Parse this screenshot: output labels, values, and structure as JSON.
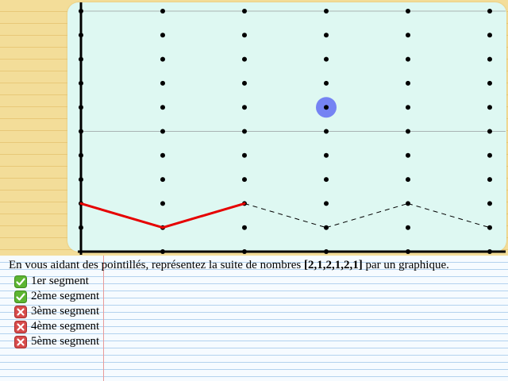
{
  "instruction": {
    "prefix": "En vous aidant des pointillés, représentez la suite de nombres ",
    "sequence": "[2,1,2,1,2,1]",
    "suffix": " par un graphique."
  },
  "segments": [
    {
      "label": "1er segment",
      "status": "done",
      "icon": "check-icon"
    },
    {
      "label": "2ème segment",
      "status": "done",
      "icon": "check-icon"
    },
    {
      "label": "3ème segment",
      "status": "todo",
      "icon": "cross-icon"
    },
    {
      "label": "4ème segment",
      "status": "todo",
      "icon": "cross-icon"
    },
    {
      "label": "5ème segment",
      "status": "todo",
      "icon": "cross-icon"
    }
  ],
  "graph": {
    "columns": 6,
    "rows": 10,
    "sequence": [
      2,
      1,
      2,
      1,
      2,
      1
    ],
    "drawn_segments": 2,
    "cursor": {
      "col": 3,
      "row": 6
    },
    "colors": {
      "background": "#def8f2",
      "axis": "#000000",
      "grid_line": "#a9b3b3",
      "dot": "#000000",
      "drawn": "#e60000",
      "guide": "#000000",
      "cursor": "#6f7cf2",
      "check": "#5cb532",
      "cross": "#d74b4b"
    }
  }
}
